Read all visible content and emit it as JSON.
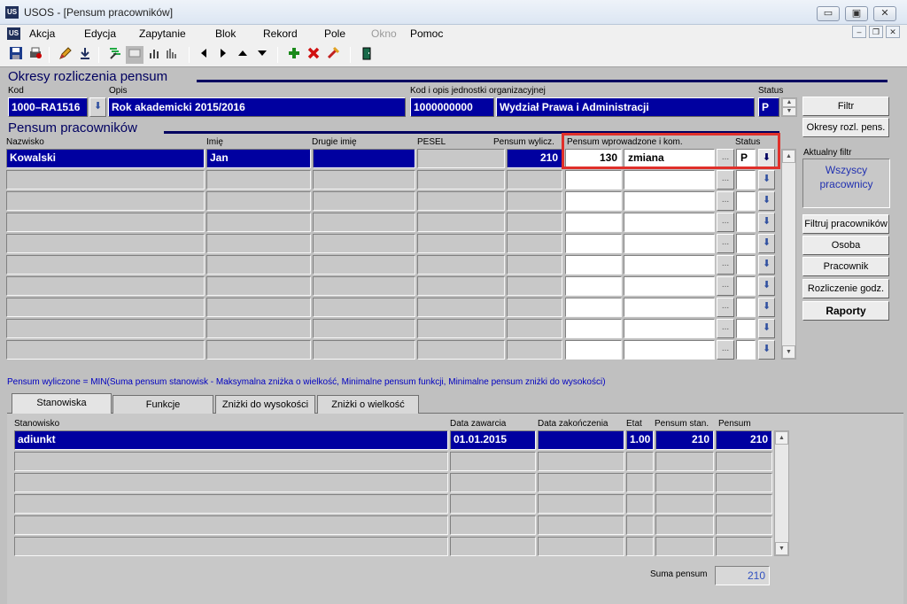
{
  "window": {
    "title": "USOS - [Pensum pracowników]",
    "app_icon": "usos-app-icon",
    "min": "▭",
    "max": "▣",
    "close": "✕"
  },
  "menu": [
    "Akcja",
    "Edycja",
    "Zapytanie",
    "Blok",
    "Rekord",
    "Pole",
    "Okno",
    "Pomoc"
  ],
  "mdi": {
    "min": "–",
    "restore": "❐",
    "close": "✕"
  },
  "okresy": {
    "title": "Okresy rozliczenia pensum",
    "labels": {
      "kod": "Kod",
      "opis": "Opis",
      "jednostka": "Kod i opis jednostki organizacyjnej",
      "status": "Status"
    },
    "kod": "1000–RA1516",
    "opis": "Rok akademicki 2015/2016",
    "jed_kod": "1000000000",
    "jed_opis": "Wydział Prawa i Administracji",
    "status": "P"
  },
  "side_buttons": {
    "filtr": "Filtr",
    "okresy": "Okresy rozl. pens.",
    "aktualny_filtr_label": "Aktualny filtr",
    "aktualny_filtr_value": "Wszyscy pracownicy",
    "filtruj": "Filtruj pracowników",
    "osoba": "Osoba",
    "pracownik": "Pracownik",
    "rozliczenie": "Rozliczenie godz.",
    "raporty": "Raporty"
  },
  "pensum": {
    "title": "Pensum pracowników",
    "columns": {
      "nazwisko": "Nazwisko",
      "imie": "Imię",
      "drugie": "Drugie imię",
      "pesel": "PESEL",
      "wyliczone": "Pensum wylicz.",
      "wprowadzone": "Pensum wprowadzone i kom.",
      "status": "Status"
    },
    "row": {
      "nazwisko": "Kowalski",
      "imie": "Jan",
      "drugie": "",
      "pesel": "",
      "wyliczone": "210",
      "wprowadzone": "130",
      "komentarz": "zmiana",
      "status": "P"
    },
    "dots": "...",
    "lov": "⬇"
  },
  "formula": "Pensum wyliczone = MIN(Suma pensum stanowisk - Maksymalna zniżka o wielkość, Minimalne pensum funkcji, Minimalne pensum zniżki do wysokości)",
  "tabs": [
    "Stanowiska",
    "Funkcje",
    "Zniżki do wysokości",
    "Zniżki o wielkość"
  ],
  "stanowiska": {
    "columns": {
      "stanowisko": "Stanowisko",
      "data_zawarcia": "Data zawarcia",
      "data_zakonczenia": "Data zakończenia",
      "etat": "Etat",
      "pensum_stan": "Pensum stan.",
      "pensum": "Pensum"
    },
    "row": {
      "stanowisko": "adiunkt",
      "data_zawarcia": "01.01.2015",
      "data_zakonczenia": "",
      "etat": "1.00",
      "pensum_stan": "210",
      "pensum": "210"
    }
  },
  "suma": {
    "label": "Suma pensum",
    "value": "210"
  },
  "colors": {
    "field_blue": "#0000a0",
    "title_navy": "#000060",
    "highlight_red": "#e0302a",
    "background": "#c0c0c0"
  }
}
